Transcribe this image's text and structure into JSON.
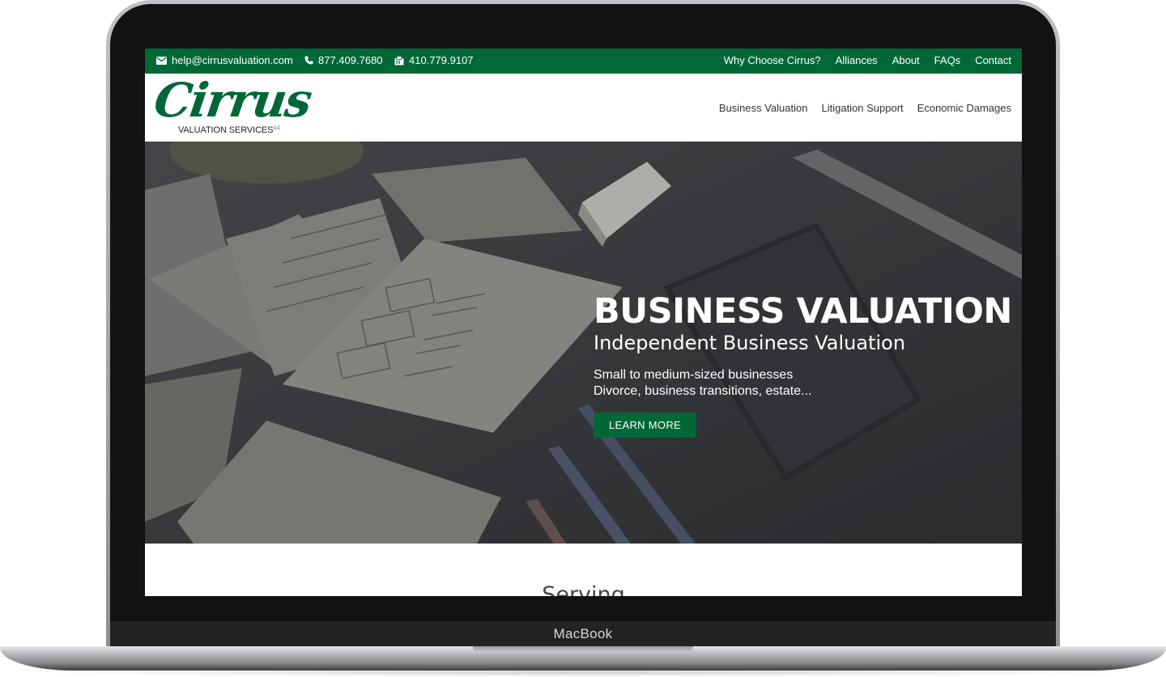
{
  "device": {
    "label": "MacBook"
  },
  "topbar": {
    "email": "help@cirrusvaluation.com",
    "phone": "877.409.7680",
    "fax": "410.779.9107",
    "icons": [
      "envelope-icon",
      "phone-icon",
      "fax-icon"
    ],
    "links": [
      "Why Choose Cirrus?",
      "Alliances",
      "About",
      "FAQs",
      "Contact"
    ]
  },
  "logo": {
    "word": "Cirrus",
    "subtitle": "VALUATION SERVICES",
    "suffix": "LLC"
  },
  "nav": [
    "Business Valuation",
    "Litigation Support",
    "Economic Damages"
  ],
  "hero": {
    "title": "BUSINESS VALUATION",
    "subtitle": "Independent Business Valuation",
    "lines": [
      "Small to medium-sized businesses",
      "Divorce, business transitions, estate..."
    ],
    "button": "LEARN MORE"
  },
  "section": {
    "heading": "Serving"
  },
  "colors": {
    "brand_green": "#006837",
    "hero_overlay": "#3a3b3e",
    "text": "#333333"
  }
}
